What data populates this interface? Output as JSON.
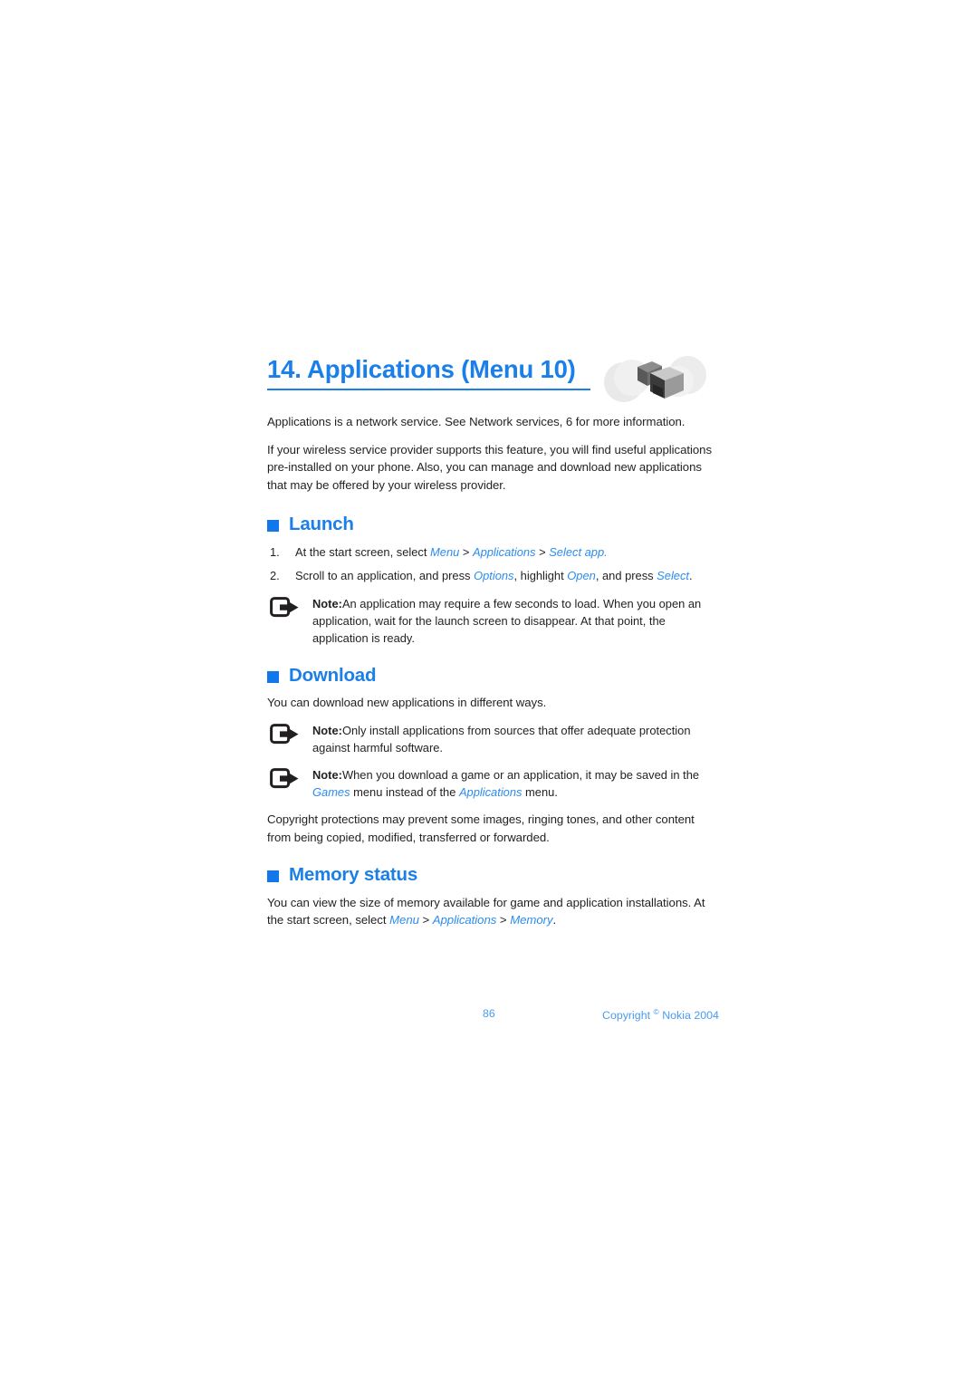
{
  "chapter": {
    "title": "14. Applications (Menu 10)",
    "artwork_icon": "grayscale-cube-artwork",
    "accent_color": "#1a7fe8"
  },
  "intro": {
    "paragraph_1": "Applications is a network service. See Network services, 6 for more information.",
    "paragraph_2": "If your wireless service provider supports this feature, you will find useful applications pre-installed on your phone. Also, you can manage and download new applications that may be offered by your wireless provider."
  },
  "sections": [
    {
      "id": "launch",
      "heading": "Launch",
      "bullet_icon": "square-bullet-icon"
    },
    {
      "id": "download",
      "heading": "Download",
      "bullet_icon": "square-bullet-icon"
    },
    {
      "id": "memory-status",
      "heading": "Memory status",
      "bullet_icon": "square-bullet-icon"
    }
  ],
  "launch": {
    "steps": [
      {
        "num": "1.",
        "lead": "At the start screen, select ",
        "path": [
          "Menu",
          "Applications",
          "Select app."
        ],
        "separator": " > "
      },
      {
        "num": "2.",
        "text_1": "Scroll to an application, and press ",
        "term_1": "Options",
        "text_2": ", highlight ",
        "term_2": "Open",
        "text_3": ", and press ",
        "term_3": "Select",
        "text_4": "."
      }
    ],
    "note": {
      "icon": "note-arrow-icon",
      "label": "Note:",
      "text": "An application may require a few seconds to load. When you open an application, wait for the launch screen to disappear. At that point, the application is ready."
    }
  },
  "download": {
    "intro": "You can download new applications in different ways.",
    "note_1": {
      "icon": "note-arrow-icon",
      "label": "Note:",
      "text": "Only install applications from sources that offer adequate protection against harmful software."
    },
    "note_2": {
      "icon": "note-arrow-icon",
      "label": "Note:",
      "text_1": "When you download a game or an application, it may be saved in the ",
      "term_1": "Games",
      "text_2": " menu instead of the ",
      "term_2": "Applications",
      "text_3": " menu."
    },
    "copyright_paragraph": "Copyright protections may prevent some images, ringing tones, and other content from being copied, modified, transferred or forwarded."
  },
  "memory_status": {
    "text_1": "You can view the size of memory available for game and application installations. At the start screen, select ",
    "path": [
      "Menu",
      "Applications",
      "Memory"
    ],
    "separator": " > ",
    "text_end": "."
  },
  "footer": {
    "page_number": "86",
    "copyright_prefix": "Copyright ",
    "copyright_symbol": "©",
    "copyright_suffix": " Nokia 2004"
  }
}
